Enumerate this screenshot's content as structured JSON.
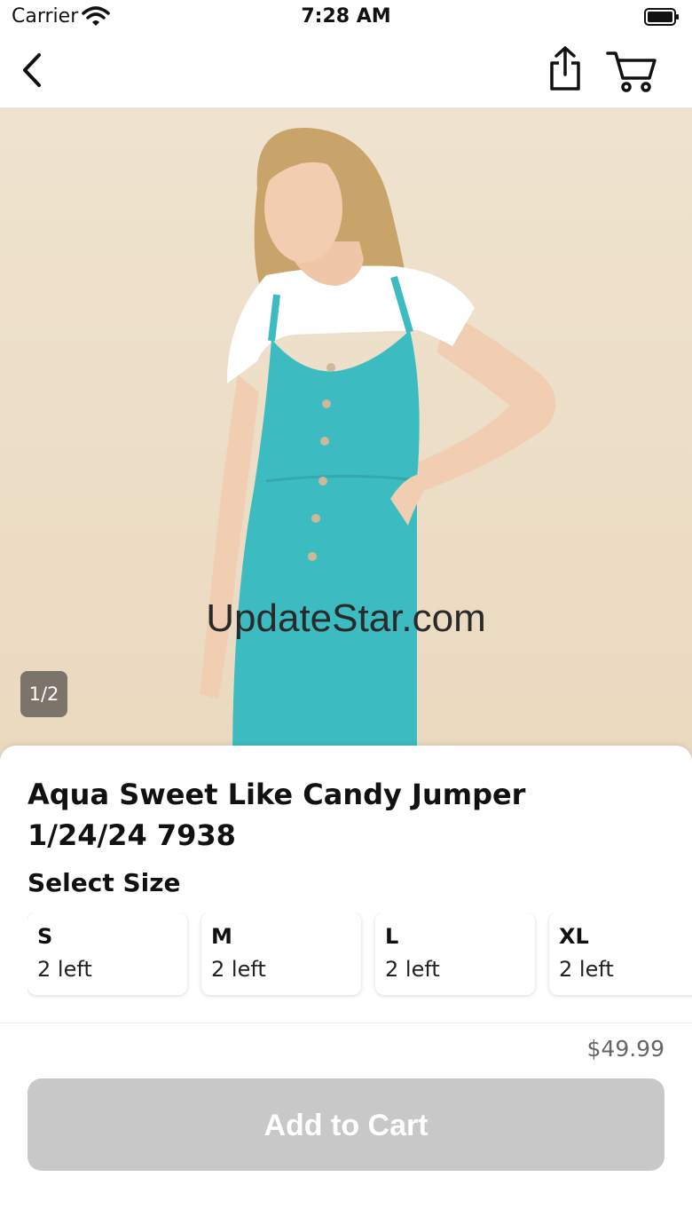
{
  "status_bar": {
    "carrier": "Carrier",
    "time": "7:28 AM"
  },
  "nav": {
    "back_icon": "chevron-left-icon",
    "share_icon": "share-icon",
    "cart_icon": "cart-icon"
  },
  "gallery": {
    "watermark": "UpdateStar.com",
    "counter": "1/2"
  },
  "product": {
    "title": "Aqua Sweet Like Candy Jumper 1/24/24 7938",
    "select_size_label": "Select Size"
  },
  "sizes": [
    {
      "name": "S",
      "stock": "2 left"
    },
    {
      "name": "M",
      "stock": "2 left"
    },
    {
      "name": "L",
      "stock": "2 left"
    },
    {
      "name": "XL",
      "stock": "2 left"
    }
  ],
  "footer": {
    "price": "$49.99",
    "add_to_cart_label": "Add to Cart"
  },
  "colors": {
    "button_disabled": "#c8c8c8",
    "jumper": "#3cbcc0",
    "background": "#efe3cf"
  }
}
